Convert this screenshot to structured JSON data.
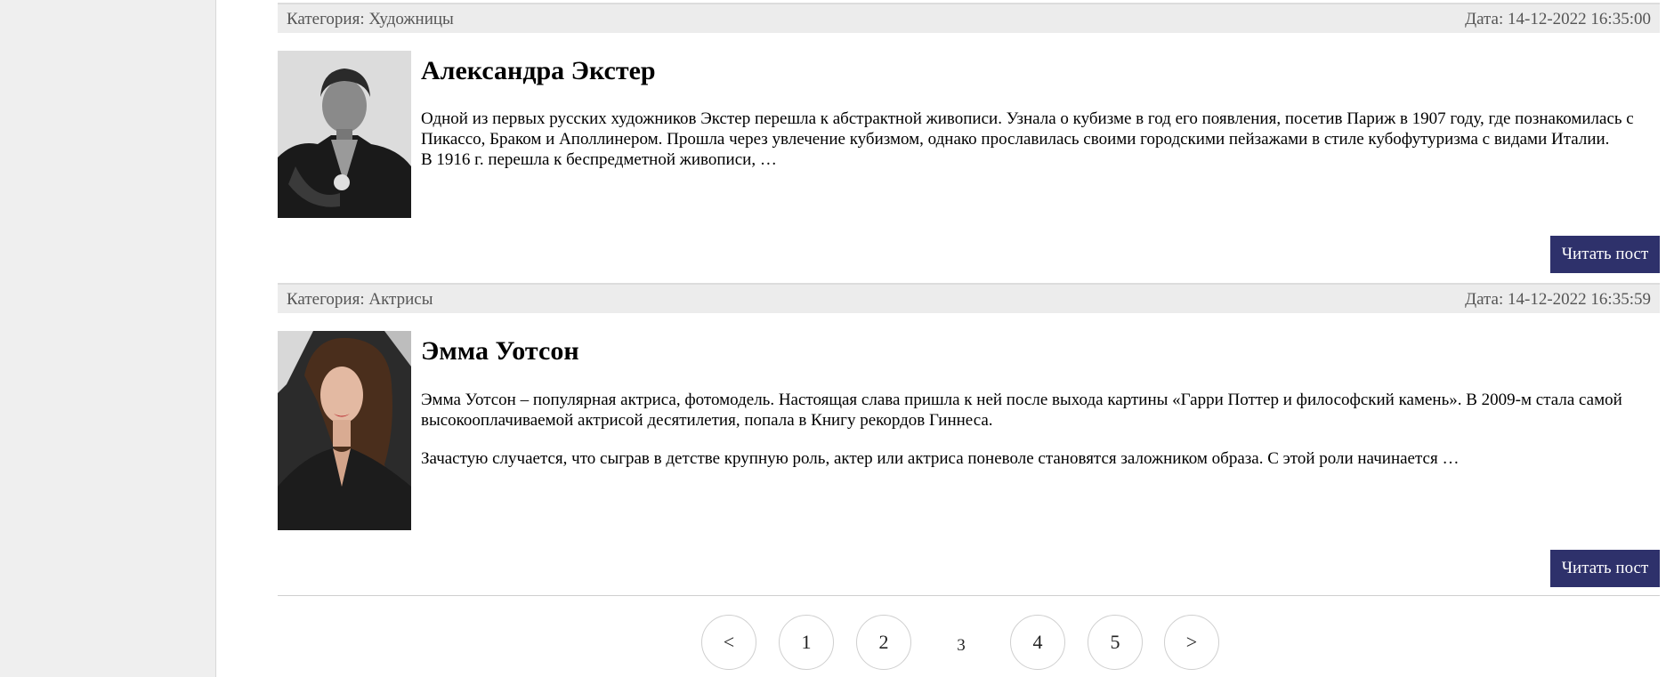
{
  "posts": [
    {
      "category": "Категория: Художницы",
      "date": "Дата: 14-12-2022 16:35:00",
      "title": "Александра Экстер",
      "paragraphs": [
        "Одной из первых русских художников Экстер перешла к абстрактной живописи. Узнала о кубизме в год его появления, посетив Париж в 1907 году, где познакомилась с Пикассо, Браком и Аполлинером. Прошла через увлечение кубизмом, однако прославилась своими городскими пейзажами в стиле кубофутуризма с видами Италии.",
        "В 1916 г. перешла к беспредметной живописи, …"
      ],
      "button": "Читать пост"
    },
    {
      "category": "Категория: Актрисы",
      "date": "Дата: 14-12-2022 16:35:59",
      "title": "Эмма Уотсон",
      "paragraphs": [
        "Эмма Уотсон – популярная актриса, фотомодель. Настоящая слава пришла к ней после выхода картины «Гарри Поттер и философский камень». В 2009-м стала самой высокооплачиваемой актрисой десятилетия, попала в Книгу рекордов Гиннеса.",
        "Зачастую случается, что сыграв в детстве крупную роль, актер или актриса поневоле становятся заложником образа. С этой роли начинается …"
      ],
      "button": "Читать пост"
    }
  ],
  "pagination": {
    "prev": "<",
    "pages": [
      "1",
      "2",
      "3",
      "4",
      "5"
    ],
    "current": "3",
    "next": ">"
  },
  "colors": {
    "button_bg": "#2e316b",
    "meta_bg": "#ececec",
    "sidebar_bg": "#efefef"
  }
}
